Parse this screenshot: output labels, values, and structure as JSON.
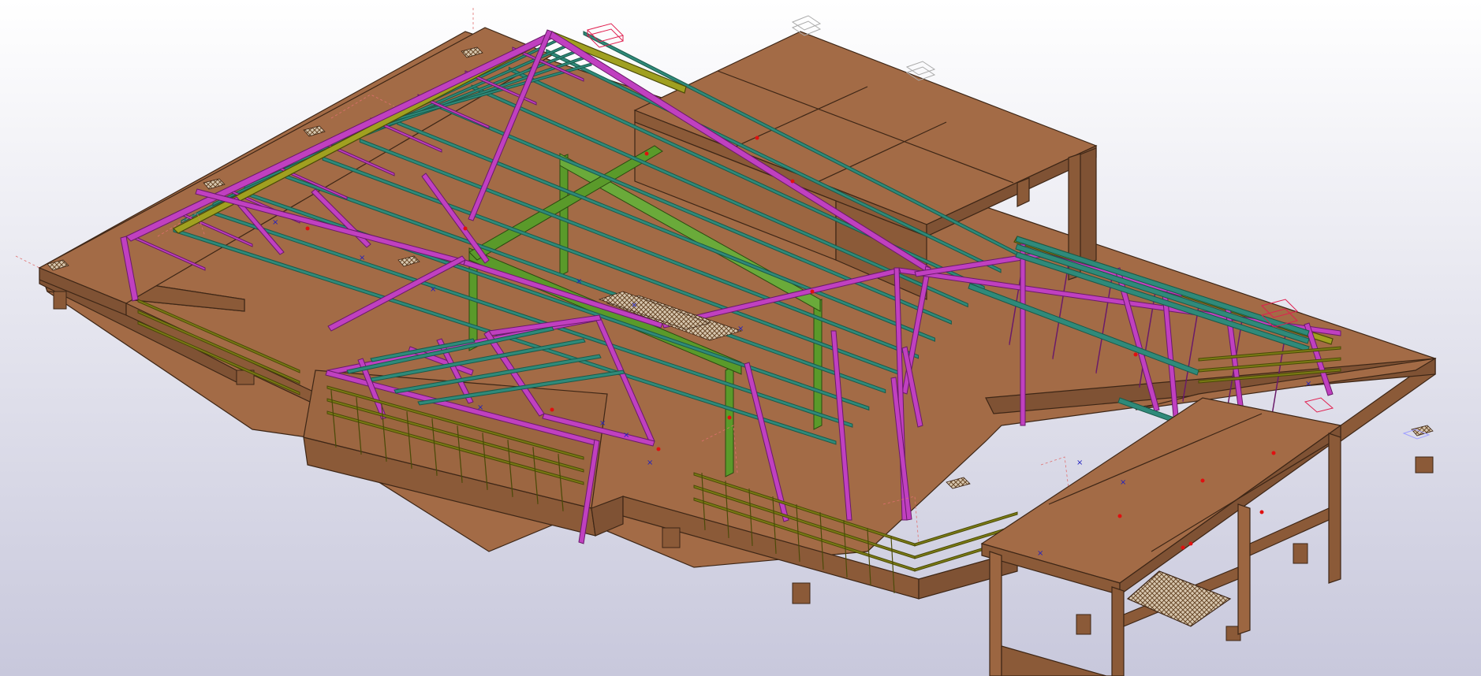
{
  "viewport": {
    "kind": "3D structural model view",
    "projection": "isometric",
    "background_top": "#ffffff",
    "background_bottom": "#c8c8dc"
  },
  "colors": {
    "concrete_face": "#9c6641",
    "concrete_top": "#a36b46",
    "concrete_side": "#7f5234",
    "edge": "#3d2616",
    "rafter": "#c040c0",
    "rafter_edge": "#6a1a6a",
    "purlin": "#2f8a7a",
    "eave_beam": "#8a8a1a",
    "girder": "#5a9a2a",
    "rail": "#6b6b10",
    "bolt_red": "#e01010",
    "bolt_blue": "#2020c0",
    "grating": "#d8c8b0",
    "hidden_line": "#e07070"
  },
  "icons": [
    "axis-triad-icon",
    "work-plane-icon",
    "point-marker-icon"
  ]
}
